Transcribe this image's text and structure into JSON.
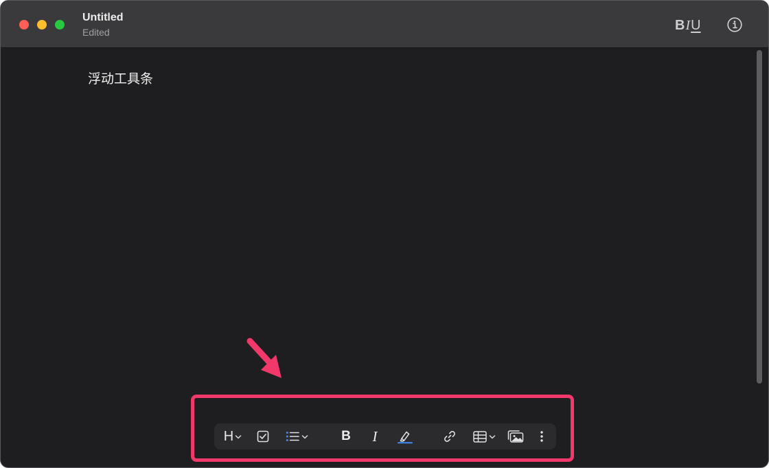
{
  "window": {
    "title": "Untitled",
    "subtitle": "Edited",
    "format_bold": "B",
    "format_italic": "I",
    "format_underline": "U",
    "info_icon": "info-circle-icon"
  },
  "document": {
    "text": "浮动工具条"
  },
  "toolbar": {
    "heading_label": "H",
    "bold_label": "B",
    "italic_label": "I",
    "items": [
      "heading-dropdown",
      "checklist",
      "bullet-list-dropdown",
      "bold",
      "italic",
      "highlighter",
      "link",
      "table-dropdown",
      "image",
      "more"
    ]
  },
  "annotation": {
    "highlight_color": "#f0386b"
  },
  "colors": {
    "window_bg": "#1e1e20",
    "titlebar_bg": "#3a393b",
    "toolbar_bg": "#2b2b2e",
    "close": "#ff5f57",
    "minimize": "#febc2e",
    "maximize": "#28c840",
    "highlighter_accent": "#3d8df5"
  }
}
